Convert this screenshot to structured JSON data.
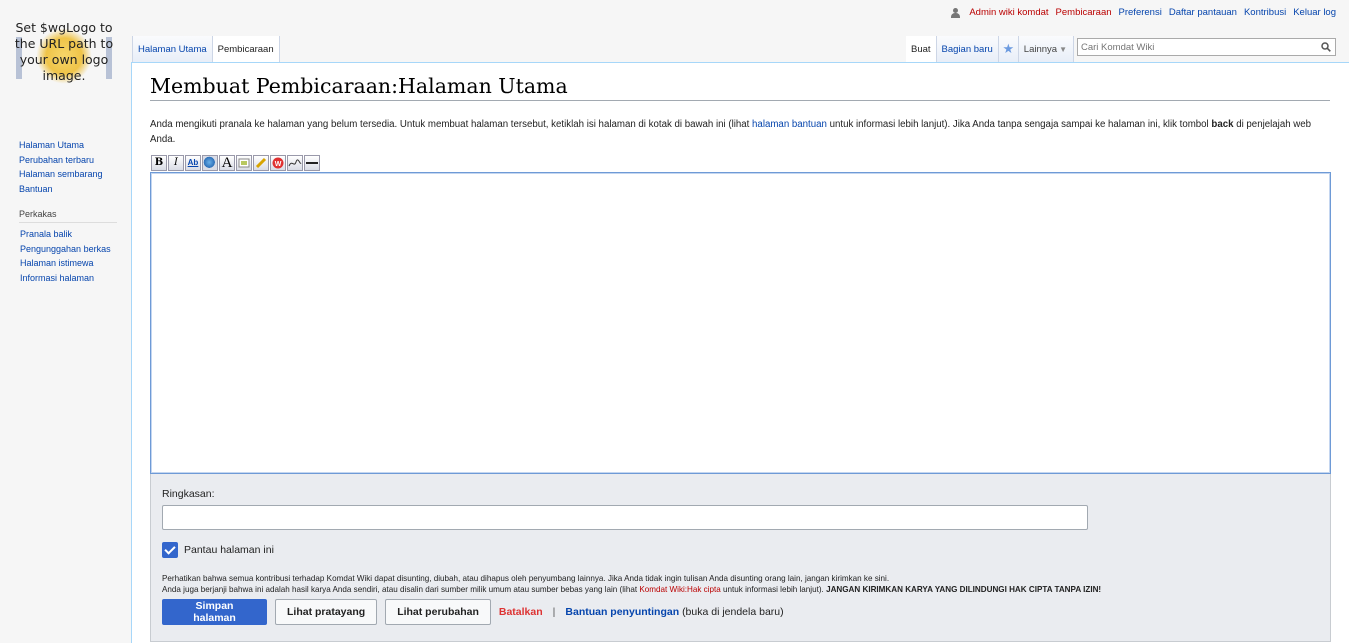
{
  "logo": {
    "text": "Set $wgLogo to the URL path to your own logo image."
  },
  "personal": [
    "Admin wiki komdat",
    "Pembicaraan",
    "Preferensi",
    "Daftar pantauan",
    "Kontribusi",
    "Keluar log"
  ],
  "left_tabs": [
    "Halaman Utama",
    "Pembicaraan"
  ],
  "right_tabs": {
    "create": "Buat",
    "new_section": "Bagian baru",
    "more": "Lainnya"
  },
  "search": {
    "placeholder": "Cari Komdat Wiki"
  },
  "sidebar": {
    "nav": [
      "Halaman Utama",
      "Perubahan terbaru",
      "Halaman sembarang",
      "Bantuan"
    ],
    "tools_heading": "Perkakas",
    "tools": [
      "Pranala balik",
      "Pengunggahan berkas",
      "Halaman istimewa",
      "Informasi halaman"
    ]
  },
  "page": {
    "title": "Membuat Pembicaraan:Halaman Utama",
    "intro_before": "Anda mengikuti pranala ke halaman yang belum tersedia. Untuk membuat halaman tersebut, ketiklah isi halaman di kotak di bawah ini (lihat ",
    "intro_link": "halaman bantuan",
    "intro_middle": " untuk informasi lebih lanjut). Jika Anda tanpa sengaja sampai ke halaman ini, klik tombol ",
    "intro_bold": "back",
    "intro_after": " di penjelajah web Anda."
  },
  "toolbar": [
    "B",
    "I",
    "Ab",
    "globe",
    "A",
    "image",
    "media",
    "no-wiki",
    "signature",
    "hr"
  ],
  "edit": {
    "summary_label": "Ringkasan:",
    "watch_label": "Pantau halaman ini",
    "copyright_line1": "Perhatikan bahwa semua kontribusi terhadap Komdat Wiki dapat disunting, diubah, atau dihapus oleh penyumbang lainnya. Jika Anda tidak ingin tulisan Anda disunting orang lain, jangan kirimkan ke sini.",
    "copyright_line2_before": "Anda juga berjanji bahwa ini adalah hasil karya Anda sendiri, atau disalin dari sumber milik umum atau sumber bebas yang lain (lihat ",
    "copyright_link": "Komdat Wiki:Hak cipta",
    "copyright_line2_after": " untuk informasi lebih lanjut). ",
    "copyright_bold": "JANGAN KIRIMKAN KARYA YANG DILINDUNGI HAK CIPTA TANPA IZIN!",
    "save": "Simpan halaman",
    "preview": "Lihat pratayang",
    "diff": "Lihat perubahan",
    "cancel": "Batalkan",
    "separator": "|",
    "help": "Bantuan penyuntingan",
    "help_note": "(buka di jendela baru)"
  }
}
